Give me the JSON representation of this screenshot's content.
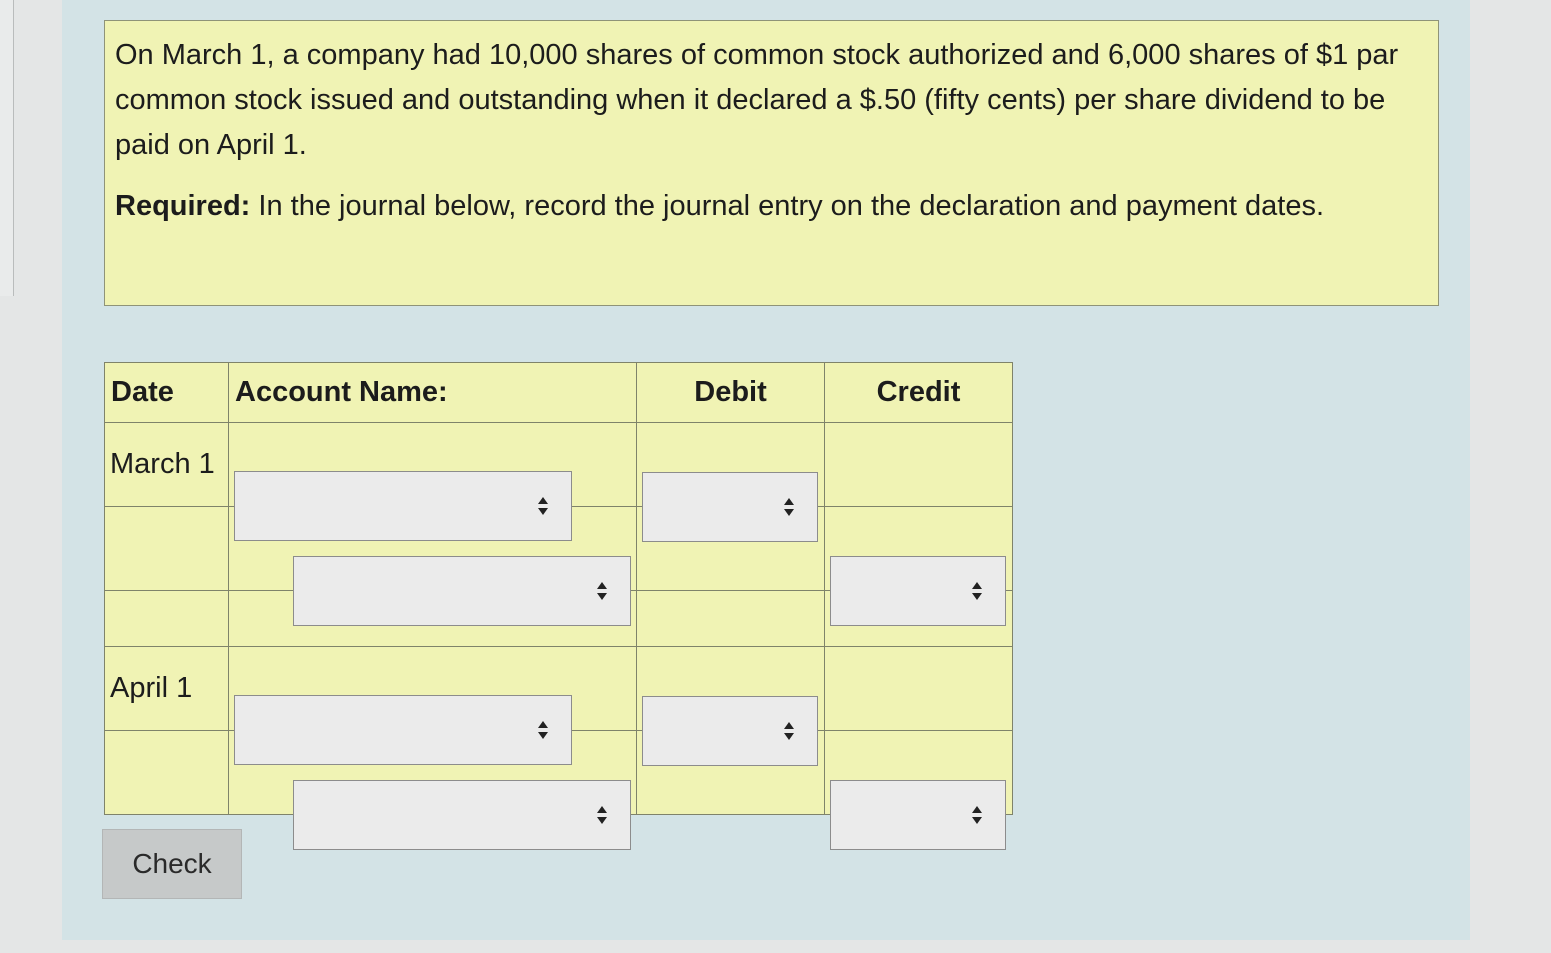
{
  "problem": {
    "text": "On March 1, a company had 10,000 shares of common stock authorized and 6,000 shares of $1 par common stock issued and outstanding when it declared a $.50 (fifty cents) per share dividend to be paid on April 1.",
    "required_label": "Required:",
    "required_text": " In the journal below, record the journal entry on the declaration and payment dates."
  },
  "journal": {
    "headers": {
      "date": "Date",
      "account": "Account Name:",
      "debit": "Debit",
      "credit": "Credit"
    },
    "rows": [
      {
        "date": "March 1"
      },
      {
        "date": ""
      },
      {
        "date": ""
      },
      {
        "date": "April 1"
      },
      {
        "date": ""
      }
    ]
  },
  "check_button": "Check",
  "colors": {
    "problem_bg": "#f0f3b4",
    "panel_bg": "#d3e3e6",
    "select_bg": "#ebebeb"
  }
}
